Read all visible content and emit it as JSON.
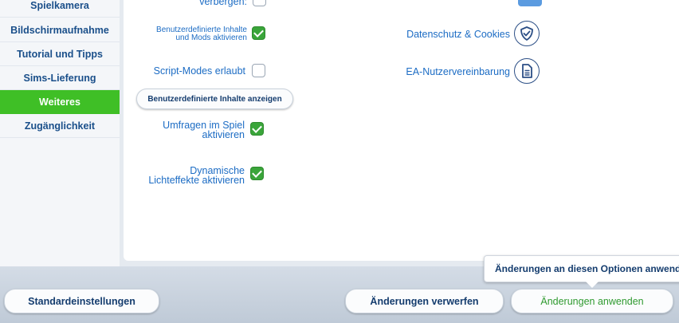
{
  "nav": {
    "items": [
      {
        "label": "Spielkamera"
      },
      {
        "label": "Bildschirmaufnahme"
      },
      {
        "label": "Tutorial und Tipps"
      },
      {
        "label": "Sims-Lieferung"
      },
      {
        "label": "Weiteres",
        "active": true
      },
      {
        "label": "Zugänglichkeit"
      }
    ]
  },
  "options": {
    "hide_label": "verbergen:",
    "custom_content_label_line1": "Benutzerdefinierte Inhalte",
    "custom_content_label_line2": "und Mods aktivieren",
    "custom_content_checked": true,
    "script_mods_label": "Script-Modes erlaubt",
    "script_mods_checked": false,
    "show_custom_content_button": "Benutzerdefinierte Inhalte anzeigen",
    "surveys_label_line1": "Umfragen im Spiel",
    "surveys_label_line2": "aktivieren",
    "surveys_checked": true,
    "dynamic_light_line1": "Dynamische",
    "dynamic_light_line2": "Lichteffekte aktivieren",
    "dynamic_light_checked": true
  },
  "links": {
    "privacy_label": "Datenschutz & Cookies",
    "privacy_icon": "shield-check-icon",
    "eula_label": "EA-Nutzervereinbarung",
    "eula_icon": "document-icon"
  },
  "footer": {
    "defaults_button": "Standardeinstellungen",
    "discard_button": "Änderungen verwerfen",
    "apply_button": "Änderungen anwenden",
    "tooltip": "Änderungen an diesen Optionen anwende"
  },
  "colors": {
    "accent_green": "#3fbf26",
    "label_blue": "#1c6cc4",
    "dark_navy": "#143c6e"
  }
}
